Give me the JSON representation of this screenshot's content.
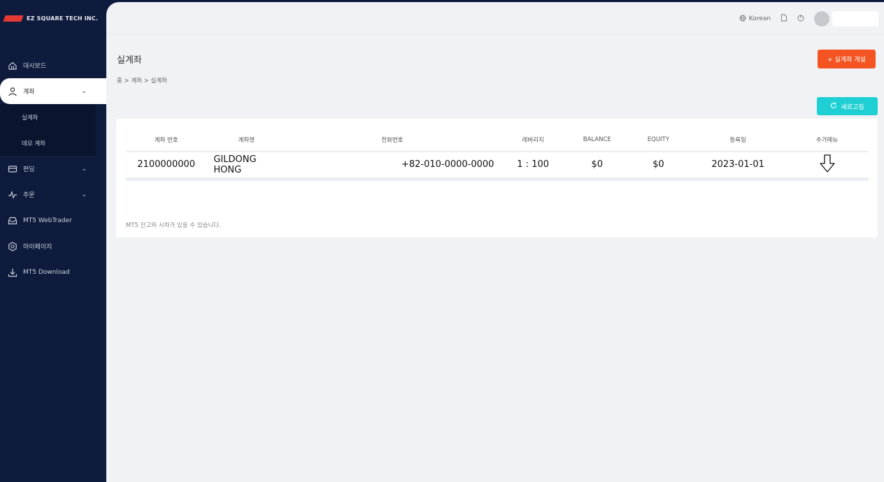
{
  "brand": {
    "name": "EZ SQUARE TECH INC."
  },
  "sidebar": {
    "items": [
      {
        "label": "대시보드",
        "icon": "home-icon"
      },
      {
        "label": "계좌",
        "icon": "user-icon",
        "expanded": true
      },
      {
        "label": "펀딩",
        "icon": "card-icon"
      },
      {
        "label": "주문",
        "icon": "activity-icon"
      },
      {
        "label": "MT5 WebTrader",
        "icon": "inbox-icon"
      },
      {
        "label": "마이페이지",
        "icon": "settings-hex-icon"
      },
      {
        "label": "MT5 Download",
        "icon": "download-icon"
      }
    ],
    "submenu": [
      {
        "label": "실계좌"
      },
      {
        "label": "데모 계좌"
      }
    ]
  },
  "topbar": {
    "language": "Korean"
  },
  "page": {
    "title": "실계좌",
    "breadcrumb": "홈 > 계좌 > 실계좌",
    "open_button": "+ 실계좌 개설",
    "refresh_button": "새로고침"
  },
  "table": {
    "headers": [
      "계좌 번호",
      "계좌명",
      "전화번호",
      "레버리지",
      "BALANCE",
      "EQUITY",
      "등록일",
      "추가메뉴"
    ],
    "rows": [
      {
        "account_no": "2100000000",
        "name": "GILDONG HONG",
        "phone": "+82-010-0000-0000",
        "leverage": "1 : 100",
        "balance": "$0",
        "equity": "$0",
        "date": "2023-01-01"
      }
    ]
  },
  "note": "MT5 잔고와 시차가 있을 수 있습니다.",
  "colors": {
    "sidebar": "#0f1b3d",
    "accent_orange": "#f35421",
    "accent_cyan": "#1ed0d3"
  }
}
